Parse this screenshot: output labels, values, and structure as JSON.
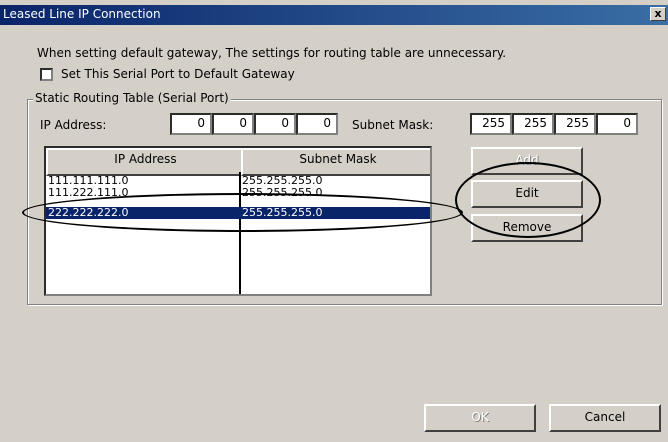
{
  "window": {
    "title": "Leased Line IP Connection",
    "close_label": "x"
  },
  "info_text": "When setting default gateway, The settings for routing table are unnecessary.",
  "default_gateway": {
    "label": "Set This Serial Port to Default Gateway",
    "checked": false
  },
  "static_routing": {
    "group_label": "Static Routing Table (Serial Port)",
    "ip_label": "IP Address:",
    "ip_octets": [
      "0",
      "0",
      "0",
      "0"
    ],
    "mask_label": "Subnet Mask:",
    "mask_octets": [
      "255",
      "255",
      "255",
      "0"
    ]
  },
  "route_table": {
    "columns": [
      "IP Address",
      "Subnet Mask"
    ],
    "rows": [
      {
        "ip": "111.111.111.0",
        "mask": "255.255.255.0",
        "selected": false
      },
      {
        "ip": "111.222.111.0",
        "mask": "255.255.255.0",
        "selected": false
      },
      {
        "ip": "222.222.222.0",
        "mask": "255.255.255.0",
        "selected": true
      }
    ]
  },
  "buttons": {
    "add": "Add",
    "edit": "Edit",
    "remove": "Remove",
    "ok": "OK",
    "cancel": "Cancel"
  },
  "colors": {
    "title_bar": "#0a246a",
    "selection": "#0a246a",
    "dialog_face": "#d4d0c8"
  }
}
